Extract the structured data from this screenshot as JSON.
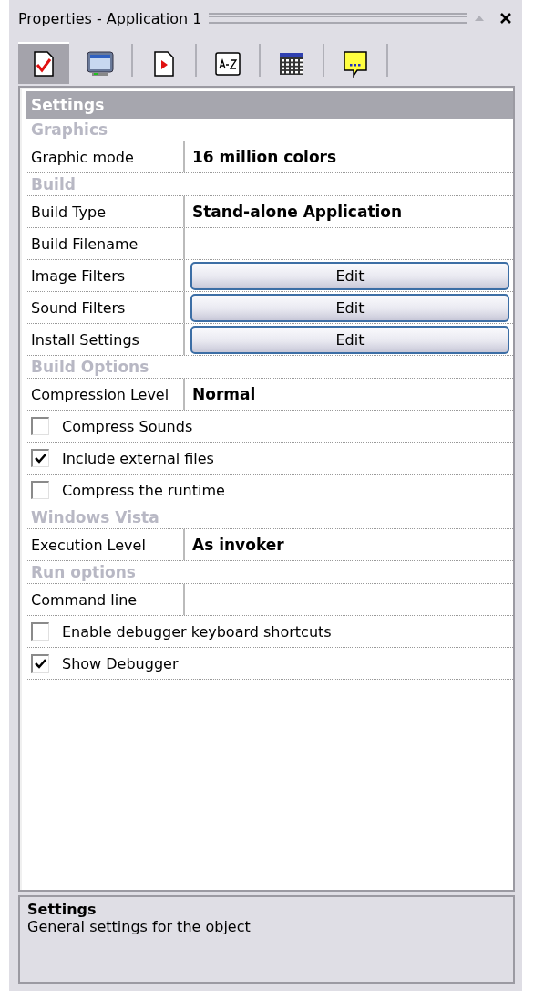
{
  "window": {
    "title": "Properties - Application 1"
  },
  "toolbar": [
    {
      "selected": true
    },
    {
      "selected": false
    },
    {
      "selected": false
    },
    {
      "selected": false
    },
    {
      "selected": false
    },
    {
      "selected": false
    }
  ],
  "grid": {
    "header": "Settings",
    "rows": [
      {
        "kind": "category",
        "label": "Graphics"
      },
      {
        "kind": "text",
        "label": "Graphic mode",
        "value": "16 million colors"
      },
      {
        "kind": "category",
        "label": "Build"
      },
      {
        "kind": "text",
        "label": "Build Type",
        "value": "Stand-alone Application"
      },
      {
        "kind": "text",
        "label": "Build Filename"
      },
      {
        "kind": "button",
        "label": "Image Filters",
        "value": "Edit"
      },
      {
        "kind": "button",
        "label": "Sound Filters",
        "value": "Edit"
      },
      {
        "kind": "button",
        "label": "Install Settings",
        "value": "Edit"
      },
      {
        "kind": "category",
        "label": "Build Options"
      },
      {
        "kind": "text",
        "label": "Compression Level",
        "value": "Normal"
      },
      {
        "kind": "checkbox",
        "label": "Compress Sounds",
        "checked": false
      },
      {
        "kind": "checkbox",
        "label": "Include external files",
        "checked": true
      },
      {
        "kind": "checkbox",
        "label": "Compress the runtime",
        "checked": false
      },
      {
        "kind": "category",
        "label": "Windows Vista"
      },
      {
        "kind": "text",
        "label": "Execution Level",
        "value": "As invoker"
      },
      {
        "kind": "category",
        "label": "Run options"
      },
      {
        "kind": "text",
        "label": "Command line"
      },
      {
        "kind": "checkbox",
        "label": "Enable debugger keyboard shortcuts",
        "checked": false
      },
      {
        "kind": "checkbox",
        "label": "Show Debugger",
        "checked": true
      }
    ]
  },
  "description": {
    "title": "Settings",
    "text": "General settings for the object"
  }
}
